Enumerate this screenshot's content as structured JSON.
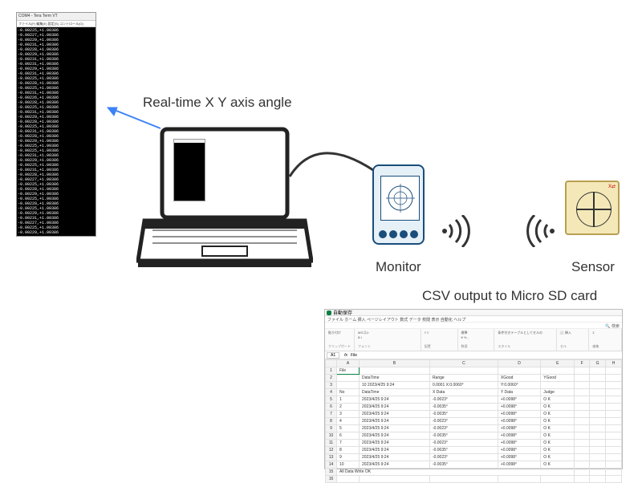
{
  "terminal": {
    "title": "COM4 - Tera Term VT",
    "menu": "ファイル(F) 編集(E) 設定(S) コントロール(O)",
    "lines": [
      "-0.00225,+1.00386",
      "-0.00227,+1.00386",
      "-0.00229,+1.00386",
      "-0.00231,+1.00386",
      "-0.00228,+1.00386",
      "-0.00229,+1.00386",
      "-0.00231,+1.00386",
      "-0.00231,+1.00386",
      "-0.00229,+1.00386",
      "-0.00231,+1.00386",
      "-0.00225,+1.00386",
      "-0.00228,+1.00386",
      "-0.00225,+1.00386",
      "-0.00231,+1.00386",
      "-0.00226,+1.00386",
      "-0.00228,+1.00386",
      "-0.00225,+1.00386",
      "-0.00231,+1.00386",
      "-0.00229,+1.00386",
      "-0.00228,+1.00386",
      "-0.00225,+1.00386",
      "-0.00231,+1.00386",
      "-0.00228,+1.00386",
      "-0.00229,+1.00386",
      "-0.00225,+1.00386",
      "-0.00225,+1.00386",
      "-0.00231,+1.00386",
      "-0.00229,+1.00386",
      "-0.00225,+1.00386",
      "-0.00231,+1.00386",
      "-0.00228,+1.00386",
      "-0.00227,+1.00386",
      "-0.00225,+1.00386",
      "-0.00228,+1.00386",
      "-0.00229,+1.00386",
      "-0.00225,+1.00386",
      "-0.00228,+1.00386",
      "-0.00225,+1.00386",
      "-0.00229,+1.00386",
      "-0.00231,+1.00386",
      "-0.00227,+1.00386",
      "-0.00225,+1.00386",
      "-0.00229,+1.00386"
    ]
  },
  "labels": {
    "realtime": "Real-time X Y axis angle",
    "monitor": "Monitor",
    "sensor": "Sensor",
    "csv": "CSV output to Micro SD card"
  },
  "sensor": {
    "corner": "X⇄"
  },
  "spreadsheet": {
    "title": "自動保存",
    "menu": "ファイル ホーム 挿入 ページレイアウト 数式 データ 校閲 表示 自動化 ヘルプ",
    "toolbar": {
      "g1_top": "貼り付け",
      "g1_bottom": "クリップボード",
      "g2_top": "MSゴシ",
      "g2_b": "B I",
      "g2_bottom": "フォント",
      "g3_top": "標準",
      "g3_mid": "¥ % ,",
      "g3_bottom": "数値",
      "g4_top": "条件付きテーブルとしてセルの",
      "g4_bottom": "スタイル",
      "g5_bottom": "セル",
      "search": "検索"
    },
    "cellref": {
      "ref": "A1",
      "fx": "fx",
      "val": "File"
    },
    "columns": [
      "",
      "A",
      "B",
      "C",
      "D",
      "E",
      "F",
      "G",
      "H"
    ],
    "meta_row": {
      "col_b": "DataTime",
      "col_c": "Range",
      "col_d": "XGood",
      "col_e": "YGood"
    },
    "meta_values": {
      "b": "10 2023/4/25 9:24",
      "c": "0.0001 X:0.0060°",
      "d": "Y:0.0060°"
    },
    "header_row": [
      "No",
      "DataTime",
      "X Data",
      "Y Data",
      "Judge"
    ],
    "rows": [
      [
        "1",
        "2023/4/25 9:24",
        "-0.0023°",
        "+0.0098°",
        "O K"
      ],
      [
        "2",
        "2023/4/25 9:24",
        "-0.0035°",
        "+0.0098°",
        "O K"
      ],
      [
        "3",
        "2023/4/25 9:24",
        "-0.0035°",
        "+0.0098°",
        "O K"
      ],
      [
        "4",
        "2023/4/25 9:24",
        "-0.0023°",
        "+0.0098°",
        "O K"
      ],
      [
        "5",
        "2023/4/25 9:24",
        "-0.0023°",
        "+0.0098°",
        "O K"
      ],
      [
        "6",
        "2023/4/25 9:24",
        "-0.0035°",
        "+0.0098°",
        "O K"
      ],
      [
        "7",
        "2023/4/25 9:24",
        "-0.0023°",
        "+0.0098°",
        "O K"
      ],
      [
        "8",
        "2023/4/25 9:24",
        "-0.0035°",
        "+0.0098°",
        "O K"
      ],
      [
        "9",
        "2023/4/25 9:24",
        "-0.0023°",
        "+0.0098°",
        "O K"
      ],
      [
        "10",
        "2023/4/25 9:24",
        "-0.0035°",
        "+0.0098°",
        "O K"
      ]
    ],
    "footer": "All Data Write OK"
  }
}
